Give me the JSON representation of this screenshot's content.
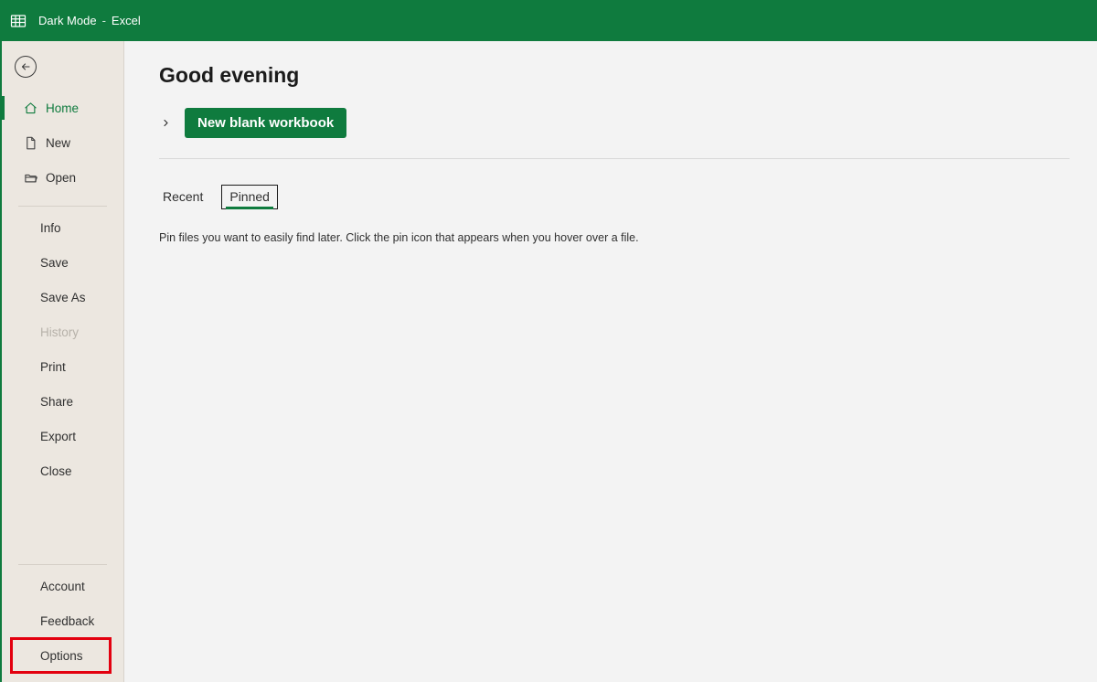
{
  "titlebar": {
    "doc": "Dark Mode",
    "separator": "-",
    "app": "Excel"
  },
  "sidebar": {
    "main": {
      "home": "Home",
      "new": "New",
      "open": "Open"
    },
    "sub": {
      "info": "Info",
      "save": "Save",
      "save_as": "Save As",
      "history": "History",
      "print": "Print",
      "share": "Share",
      "export": "Export",
      "close": "Close"
    },
    "bottom": {
      "account": "Account",
      "feedback": "Feedback",
      "options": "Options"
    }
  },
  "main": {
    "greeting": "Good evening",
    "new_button": "New blank workbook",
    "tabs": {
      "recent": "Recent",
      "pinned": "Pinned"
    },
    "empty": "Pin files you want to easily find later. Click the pin icon that appears when you hover over a file."
  }
}
